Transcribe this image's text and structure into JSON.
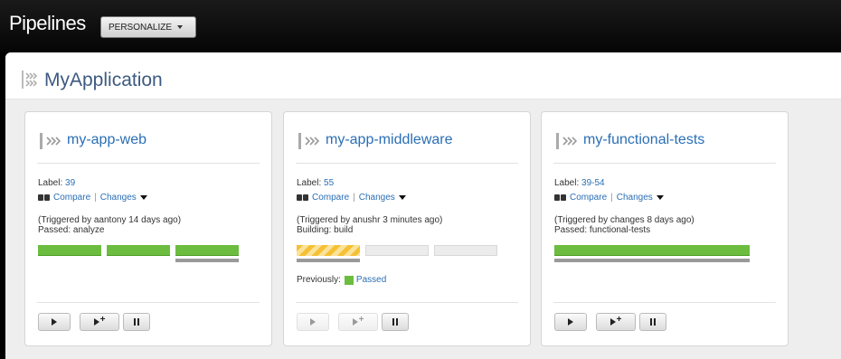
{
  "header": {
    "title": "Pipelines",
    "personalize_label": "PERSONALIZE"
  },
  "group": {
    "name": "MyApplication"
  },
  "cards": [
    {
      "name": "my-app-web",
      "label_prefix": "Label:",
      "label_value": "39",
      "compare": "Compare",
      "changes": "Changes",
      "trigger": "(Triggered by aantony 14 days ago)",
      "status": "Passed: analyze",
      "stages": [
        "passed",
        "passed",
        "passed"
      ]
    },
    {
      "name": "my-app-middleware",
      "label_prefix": "Label:",
      "label_value": "55",
      "compare": "Compare",
      "changes": "Changes",
      "trigger": "(Triggered by anushr 3 minutes ago)",
      "status": "Building: build",
      "stages": [
        "building",
        "pending",
        "pending"
      ],
      "previously_label": "Previously:",
      "previously_value": "Passed"
    },
    {
      "name": "my-functional-tests",
      "label_prefix": "Label:",
      "label_value": "39-54",
      "compare": "Compare",
      "changes": "Changes",
      "trigger": "(Triggered by changes 8 days ago)",
      "status": "Passed: functional-tests",
      "stages": [
        "passed"
      ]
    }
  ],
  "icons": {
    "pipeline": "pipeline-chevrons-icon",
    "compare": "compare-icon",
    "play": "play-icon",
    "play_with_options": "play-with-options-icon",
    "pause": "pause-icon"
  },
  "colors": {
    "link": "#2a6fb5",
    "passed": "#6cbd3f",
    "building": "#f5c033",
    "topbar": "#000000"
  }
}
